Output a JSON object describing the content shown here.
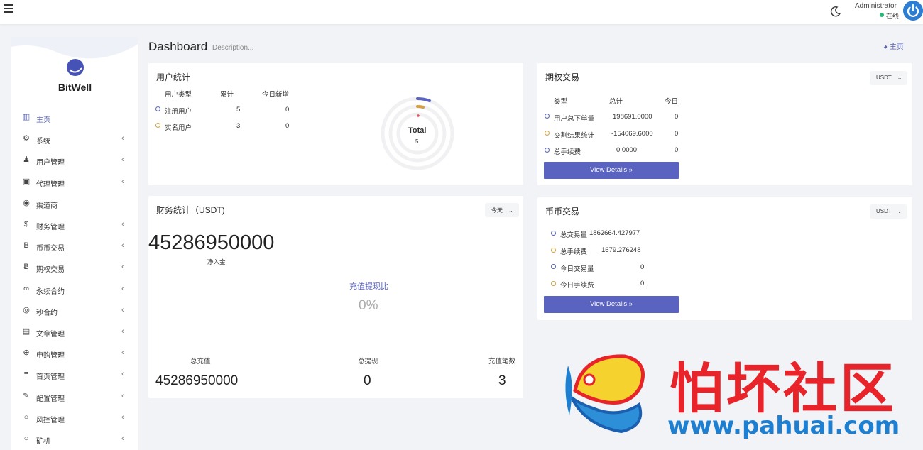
{
  "topbar": {
    "admin_name": "Administrator",
    "status_text": "在线"
  },
  "sidebar": {
    "logo_text": "BitWell",
    "items": [
      {
        "label": "主页",
        "icon": "bar-chart-icon",
        "has_children": false
      },
      {
        "label": "系统",
        "icon": "gear-icon",
        "has_children": true
      },
      {
        "label": "用户管理",
        "icon": "user-tie-icon",
        "has_children": true
      },
      {
        "label": "代理管理",
        "icon": "id-card-icon",
        "has_children": true
      },
      {
        "label": "渠道商",
        "icon": "user-circle-icon",
        "has_children": false
      },
      {
        "label": "财务管理",
        "icon": "dollar-icon",
        "has_children": true
      },
      {
        "label": "币币交易",
        "icon": "bitcoin-icon",
        "has_children": true
      },
      {
        "label": "期权交易",
        "icon": "bitcoin-circle-icon",
        "has_children": true
      },
      {
        "label": "永续合约",
        "icon": "link-icon",
        "has_children": true
      },
      {
        "label": "秒合约",
        "icon": "dot-circle-icon",
        "has_children": true
      },
      {
        "label": "文章管理",
        "icon": "newspaper-icon",
        "has_children": true
      },
      {
        "label": "申购管理",
        "icon": "life-ring-icon",
        "has_children": true
      },
      {
        "label": "首页管理",
        "icon": "list-icon",
        "has_children": true
      },
      {
        "label": "配置管理",
        "icon": "wrench-icon",
        "has_children": true
      },
      {
        "label": "风控管理",
        "icon": "circle-icon",
        "has_children": true
      },
      {
        "label": "矿机",
        "icon": "circle-icon",
        "has_children": true
      }
    ]
  },
  "header": {
    "title": "Dashboard",
    "description": "Description...",
    "breadcrumb": "主页"
  },
  "user_stats": {
    "title": "用户统计",
    "headers": [
      "用户类型",
      "累计",
      "今日新增"
    ],
    "rows": [
      {
        "type": "注册用户",
        "total": "5",
        "today": "0"
      },
      {
        "type": "实名用户",
        "total": "3",
        "today": "0"
      }
    ],
    "donut_label": "Total",
    "donut_value": "5"
  },
  "option_trade": {
    "title": "期权交易",
    "currency": "USDT",
    "headers": [
      "类型",
      "总计",
      "今日"
    ],
    "rows": [
      {
        "type": "用户总下单量",
        "total": "198691.0000",
        "today": "0"
      },
      {
        "type": "交割结果统计",
        "total": "-154069.6000",
        "today": "0"
      },
      {
        "type": "总手续费",
        "total": "0.0000",
        "today": "0"
      }
    ],
    "button": "View Details »"
  },
  "finance": {
    "title": "财务统计（USDT)",
    "period": "今天",
    "net_value": "45286950000",
    "net_label": "净入金",
    "ratio_label": "充值提现比",
    "ratio_value": "0%",
    "totals": [
      {
        "label": "总充值",
        "value": "45286950000"
      },
      {
        "label": "总提现",
        "value": "0"
      },
      {
        "label": "充值笔数",
        "value": "3"
      }
    ]
  },
  "coin_trade": {
    "title": "币币交易",
    "currency": "USDT",
    "rows": [
      {
        "label": "总交易量",
        "value": "1862664.427977"
      },
      {
        "label": "总手续费",
        "value": "1679.276248"
      },
      {
        "label": "今日交易量",
        "value": "0"
      },
      {
        "label": "今日手续费",
        "value": "0"
      }
    ],
    "button": "View Details »"
  },
  "watermark": {
    "chinese": "怕坏社区",
    "url": "www.pahuai.com"
  },
  "colors": {
    "accent": "#5a64c0",
    "orange": "#d4a146",
    "online": "#2bb673",
    "watermark_red": "#e8232a",
    "watermark_blue": "#1d7fd1"
  }
}
